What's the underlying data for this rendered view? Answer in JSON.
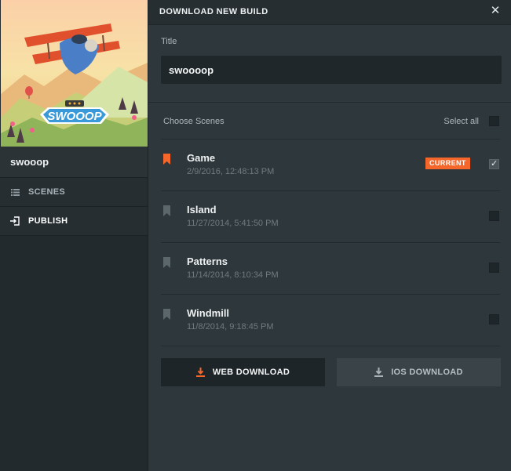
{
  "sidebar": {
    "app_name": "swooop",
    "logo_text": "SWOOOP",
    "nav": [
      {
        "label": "SCENES",
        "icon": "list-icon"
      },
      {
        "label": "PUBLISH",
        "icon": "publish-icon"
      }
    ]
  },
  "dialog": {
    "title": "DOWNLOAD NEW BUILD",
    "title_label": "Title",
    "title_value": "swoooop",
    "choose_scenes_label": "Choose Scenes",
    "select_all_label": "Select all",
    "select_all_checked": false,
    "scenes": [
      {
        "name": "Game",
        "date": "2/9/2016, 12:48:13 PM",
        "current": true,
        "badge": "CURRENT",
        "checked": true
      },
      {
        "name": "Island",
        "date": "11/27/2014, 5:41:50 PM",
        "current": false,
        "checked": false
      },
      {
        "name": "Patterns",
        "date": "11/14/2014, 8:10:34 PM",
        "current": false,
        "checked": false
      },
      {
        "name": "Windmill",
        "date": "11/8/2014, 9:18:45 PM",
        "current": false,
        "checked": false
      }
    ],
    "buttons": {
      "web_download": "WEB DOWNLOAD",
      "ios_download": "IOS DOWNLOAD"
    }
  },
  "colors": {
    "accent": "#f4662a",
    "bookmark_inactive": "#5c676c"
  }
}
